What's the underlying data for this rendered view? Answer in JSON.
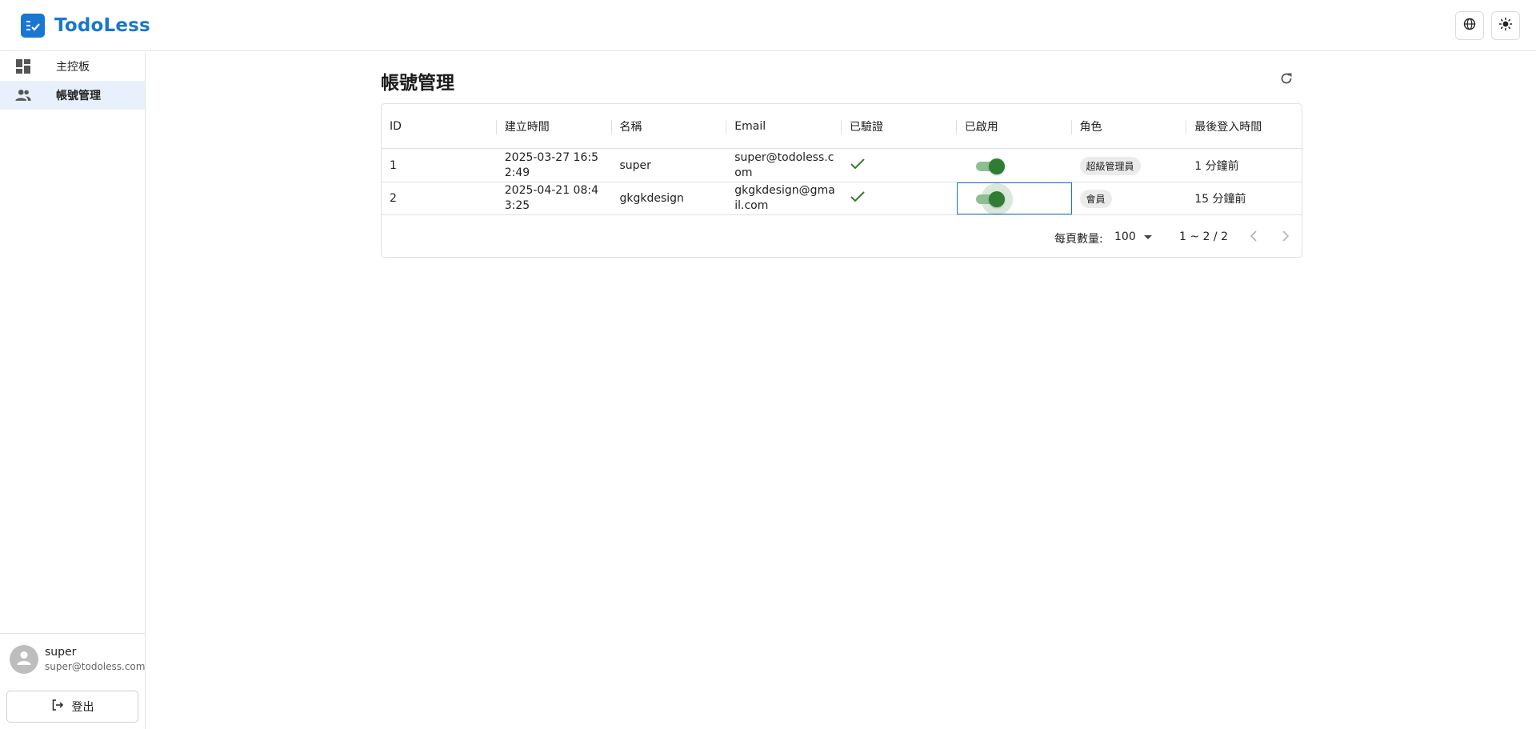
{
  "app": {
    "name": "TodoLess",
    "brand_color": "#1976d2"
  },
  "header": {
    "icons": [
      "globe-icon",
      "theme-toggle-icon"
    ]
  },
  "sidebar": {
    "items": [
      {
        "label": "主控板",
        "icon": "dashboard-icon",
        "active": false
      },
      {
        "label": "帳號管理",
        "icon": "people-icon",
        "active": true
      }
    ],
    "user": {
      "name": "super",
      "email": "super@todoless.com"
    },
    "logout_label": "登出"
  },
  "main": {
    "title": "帳號管理",
    "table": {
      "columns": [
        "ID",
        "建立時間",
        "名稱",
        "Email",
        "已驗證",
        "已啟用",
        "角色",
        "最後登入時間"
      ],
      "rows": [
        {
          "id": "1",
          "created": "2025-03-27 16:52:49",
          "name": "super",
          "email": "super@todoless.com",
          "verified": true,
          "enabled": true,
          "role": "超級管理員",
          "last_login": "1 分鐘前"
        },
        {
          "id": "2",
          "created": "2025-04-21 08:43:25",
          "name": "gkgkdesign",
          "email": "gkgkdesign@gmail.com",
          "verified": true,
          "enabled": true,
          "role": "會員",
          "last_login": "15 分鐘前"
        }
      ]
    },
    "pagination": {
      "rows_per_page_label": "每頁數量:",
      "rows_per_page": "100",
      "range": "1 ~ 2 / 2"
    }
  },
  "colors": {
    "success": "#2e7d32",
    "selected_nav_bg": "#e8f1fb"
  }
}
